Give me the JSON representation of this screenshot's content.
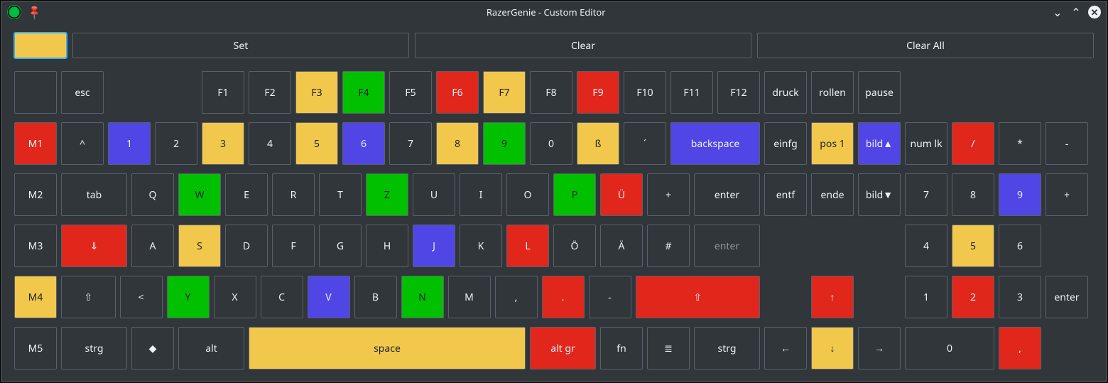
{
  "window": {
    "title": "RazerGenie - Custom Editor"
  },
  "actions": {
    "set": "Set",
    "clear": "Clear",
    "clear_all": "Clear All"
  },
  "swatch_color": "#f1c84c",
  "layout": {
    "unit": 66,
    "gap": 6,
    "height": 60,
    "row_gap": 12
  },
  "rows": [
    [
      {
        "label": "",
        "w": 1,
        "color": "none",
        "name": "key-blank-r0"
      },
      {
        "label": "esc",
        "w": 1,
        "color": "none",
        "name": "key-esc"
      },
      {
        "gap": 2
      },
      {
        "label": "F1",
        "w": 1,
        "color": "none",
        "name": "key-f1"
      },
      {
        "label": "F2",
        "w": 1,
        "color": "none",
        "name": "key-f2"
      },
      {
        "label": "F3",
        "w": 1,
        "color": "yellow",
        "name": "key-f3"
      },
      {
        "label": "F4",
        "w": 1,
        "color": "green",
        "name": "key-f4"
      },
      {
        "label": "F5",
        "w": 1,
        "color": "none",
        "name": "key-f5"
      },
      {
        "label": "F6",
        "w": 1,
        "color": "red",
        "name": "key-f6"
      },
      {
        "label": "F7",
        "w": 1,
        "color": "yellow",
        "name": "key-f7"
      },
      {
        "label": "F8",
        "w": 1,
        "color": "none",
        "name": "key-f8"
      },
      {
        "label": "F9",
        "w": 1,
        "color": "red",
        "name": "key-f9"
      },
      {
        "label": "F10",
        "w": 1,
        "color": "none",
        "name": "key-f10"
      },
      {
        "label": "F11",
        "w": 1,
        "color": "none",
        "name": "key-f11"
      },
      {
        "label": "F12",
        "w": 1,
        "color": "none",
        "name": "key-f12"
      },
      {
        "label": "druck",
        "w": 1,
        "color": "none",
        "name": "key-druck"
      },
      {
        "label": "rollen",
        "w": 1,
        "color": "none",
        "name": "key-rollen"
      },
      {
        "label": "pause",
        "w": 1,
        "color": "none",
        "name": "key-pause"
      }
    ],
    [
      {
        "label": "M1",
        "w": 1,
        "color": "red",
        "name": "key-m1"
      },
      {
        "label": "^",
        "w": 1,
        "color": "none",
        "name": "key-caret"
      },
      {
        "label": "1",
        "w": 1,
        "color": "blue",
        "name": "key-1"
      },
      {
        "label": "2",
        "w": 1,
        "color": "none",
        "name": "key-2"
      },
      {
        "label": "3",
        "w": 1,
        "color": "yellow",
        "name": "key-3"
      },
      {
        "label": "4",
        "w": 1,
        "color": "none",
        "name": "key-4"
      },
      {
        "label": "5",
        "w": 1,
        "color": "yellow",
        "name": "key-5"
      },
      {
        "label": "6",
        "w": 1,
        "color": "blue",
        "name": "key-6"
      },
      {
        "label": "7",
        "w": 1,
        "color": "none",
        "name": "key-7"
      },
      {
        "label": "8",
        "w": 1,
        "color": "yellow",
        "name": "key-8"
      },
      {
        "label": "9",
        "w": 1,
        "color": "green",
        "name": "key-9"
      },
      {
        "label": "0",
        "w": 1,
        "color": "none",
        "name": "key-0"
      },
      {
        "label": "ß",
        "w": 1,
        "color": "yellow",
        "name": "key-ss"
      },
      {
        "label": "´",
        "w": 1,
        "color": "none",
        "name": "key-acute"
      },
      {
        "label": "backspace",
        "w": 2,
        "color": "blue",
        "name": "key-backspace"
      },
      {
        "label": "einfg",
        "w": 1,
        "color": "none",
        "name": "key-einfg"
      },
      {
        "label": "pos 1",
        "w": 1,
        "color": "yellow",
        "name": "key-pos1"
      },
      {
        "label": "bild▲",
        "w": 1,
        "color": "blue",
        "name": "key-bildup"
      },
      {
        "label": "num lk",
        "w": 1,
        "color": "none",
        "name": "key-numlk"
      },
      {
        "label": "/",
        "w": 1,
        "color": "red",
        "name": "key-numdiv"
      },
      {
        "label": "*",
        "w": 1,
        "color": "none",
        "name": "key-nummul"
      },
      {
        "label": "-",
        "w": 1,
        "color": "none",
        "name": "key-numsub"
      }
    ],
    [
      {
        "label": "M2",
        "w": 1,
        "color": "none",
        "name": "key-m2"
      },
      {
        "label": "tab",
        "w": 1.5,
        "color": "none",
        "name": "key-tab"
      },
      {
        "label": "Q",
        "w": 1,
        "color": "none",
        "name": "key-q"
      },
      {
        "label": "W",
        "w": 1,
        "color": "green",
        "name": "key-w"
      },
      {
        "label": "E",
        "w": 1,
        "color": "none",
        "name": "key-e"
      },
      {
        "label": "R",
        "w": 1,
        "color": "none",
        "name": "key-r"
      },
      {
        "label": "T",
        "w": 1,
        "color": "none",
        "name": "key-t"
      },
      {
        "label": "Z",
        "w": 1,
        "color": "green",
        "name": "key-z"
      },
      {
        "label": "U",
        "w": 1,
        "color": "none",
        "name": "key-u"
      },
      {
        "label": "I",
        "w": 1,
        "color": "none",
        "name": "key-i"
      },
      {
        "label": "O",
        "w": 1,
        "color": "none",
        "name": "key-o"
      },
      {
        "label": "P",
        "w": 1,
        "color": "green",
        "name": "key-p"
      },
      {
        "label": "Ü",
        "w": 1,
        "color": "red",
        "name": "key-ue"
      },
      {
        "label": "+",
        "w": 1,
        "color": "none",
        "name": "key-plus"
      },
      {
        "label": "enter",
        "w": 1.5,
        "color": "none",
        "name": "key-enter-top"
      },
      {
        "label": "entf",
        "w": 1,
        "color": "none",
        "name": "key-entf"
      },
      {
        "label": "ende",
        "w": 1,
        "color": "none",
        "name": "key-ende"
      },
      {
        "label": "bild▼",
        "w": 1,
        "color": "none",
        "name": "key-bilddn"
      },
      {
        "label": "7",
        "w": 1,
        "color": "none",
        "name": "key-num7"
      },
      {
        "label": "8",
        "w": 1,
        "color": "none",
        "name": "key-num8"
      },
      {
        "label": "9",
        "w": 1,
        "color": "blue",
        "name": "key-num9"
      },
      {
        "label": "+",
        "w": 1,
        "color": "none",
        "name": "key-numadd"
      }
    ],
    [
      {
        "label": "M3",
        "w": 1,
        "color": "none",
        "name": "key-m3"
      },
      {
        "label": "⇓",
        "w": 1.5,
        "color": "red",
        "name": "key-caps"
      },
      {
        "label": "A",
        "w": 1,
        "color": "none",
        "name": "key-a"
      },
      {
        "label": "S",
        "w": 1,
        "color": "yellow",
        "name": "key-s"
      },
      {
        "label": "D",
        "w": 1,
        "color": "none",
        "name": "key-d"
      },
      {
        "label": "F",
        "w": 1,
        "color": "none",
        "name": "key-f"
      },
      {
        "label": "G",
        "w": 1,
        "color": "none",
        "name": "key-g"
      },
      {
        "label": "H",
        "w": 1,
        "color": "none",
        "name": "key-h"
      },
      {
        "label": "J",
        "w": 1,
        "color": "blue",
        "name": "key-j"
      },
      {
        "label": "K",
        "w": 1,
        "color": "none",
        "name": "key-k"
      },
      {
        "label": "L",
        "w": 1,
        "color": "red",
        "name": "key-l"
      },
      {
        "label": "Ö",
        "w": 1,
        "color": "none",
        "name": "key-oe"
      },
      {
        "label": "Ä",
        "w": 1,
        "color": "none",
        "name": "key-ae"
      },
      {
        "label": "#",
        "w": 1,
        "color": "none",
        "name": "key-hash"
      },
      {
        "label": "enter",
        "w": 1.5,
        "color": "none",
        "dim": true,
        "name": "key-enter-bottom"
      },
      {
        "gap": 3
      },
      {
        "label": "4",
        "w": 1,
        "color": "none",
        "name": "key-num4"
      },
      {
        "label": "5",
        "w": 1,
        "color": "yellow",
        "name": "key-num5"
      },
      {
        "label": "6",
        "w": 1,
        "color": "none",
        "name": "key-num6"
      }
    ],
    [
      {
        "label": "M4",
        "w": 1,
        "color": "yellow",
        "name": "key-m4"
      },
      {
        "label": "⇧",
        "w": 1.25,
        "color": "none",
        "name": "key-lshift"
      },
      {
        "label": "<",
        "w": 1,
        "color": "none",
        "name": "key-angle"
      },
      {
        "label": "Y",
        "w": 1,
        "color": "green",
        "name": "key-y"
      },
      {
        "label": "X",
        "w": 1,
        "color": "none",
        "name": "key-x"
      },
      {
        "label": "C",
        "w": 1,
        "color": "none",
        "name": "key-c"
      },
      {
        "label": "V",
        "w": 1,
        "color": "blue",
        "name": "key-v"
      },
      {
        "label": "B",
        "w": 1,
        "color": "none",
        "name": "key-b"
      },
      {
        "label": "N",
        "w": 1,
        "color": "green",
        "name": "key-n"
      },
      {
        "label": "M",
        "w": 1,
        "color": "none",
        "name": "key-m"
      },
      {
        "label": ",",
        "w": 1,
        "color": "none",
        "name": "key-comma"
      },
      {
        "label": ".",
        "w": 1,
        "color": "red",
        "name": "key-period"
      },
      {
        "label": "-",
        "w": 1,
        "color": "none",
        "name": "key-dash"
      },
      {
        "label": "⇧",
        "w": 2.75,
        "color": "red",
        "name": "key-rshift"
      },
      {
        "gap": 1
      },
      {
        "label": "↑",
        "w": 1,
        "color": "red",
        "name": "key-up"
      },
      {
        "gap": 1
      },
      {
        "label": "1",
        "w": 1,
        "color": "none",
        "name": "key-num1"
      },
      {
        "label": "2",
        "w": 1,
        "color": "red",
        "name": "key-num2"
      },
      {
        "label": "3",
        "w": 1,
        "color": "none",
        "name": "key-num3"
      },
      {
        "label": "enter",
        "w": 1,
        "color": "none",
        "name": "key-numenter-top"
      }
    ],
    [
      {
        "label": "M5",
        "w": 1,
        "color": "none",
        "name": "key-m5"
      },
      {
        "label": "strg",
        "w": 1.5,
        "color": "none",
        "name": "key-lstrg"
      },
      {
        "label": "◆",
        "w": 1,
        "color": "none",
        "name": "key-super"
      },
      {
        "label": "alt",
        "w": 1.5,
        "color": "none",
        "name": "key-lalt"
      },
      {
        "label": "space",
        "w": 6,
        "color": "yellow",
        "name": "key-space"
      },
      {
        "label": "alt gr",
        "w": 1.5,
        "color": "red",
        "name": "key-altgr"
      },
      {
        "label": "fn",
        "w": 1,
        "color": "none",
        "name": "key-fn"
      },
      {
        "label": "≣",
        "w": 1,
        "color": "none",
        "name": "key-menu"
      },
      {
        "label": "strg",
        "w": 1.5,
        "color": "none",
        "name": "key-rstrg"
      },
      {
        "label": "←",
        "w": 1,
        "color": "none",
        "name": "key-left"
      },
      {
        "label": "↓",
        "w": 1,
        "color": "yellow",
        "name": "key-down"
      },
      {
        "label": "→",
        "w": 1,
        "color": "none",
        "name": "key-right"
      },
      {
        "label": "0",
        "w": 2,
        "color": "none",
        "name": "key-num0"
      },
      {
        "label": ",",
        "w": 1,
        "color": "red",
        "name": "key-numcomma"
      }
    ]
  ]
}
